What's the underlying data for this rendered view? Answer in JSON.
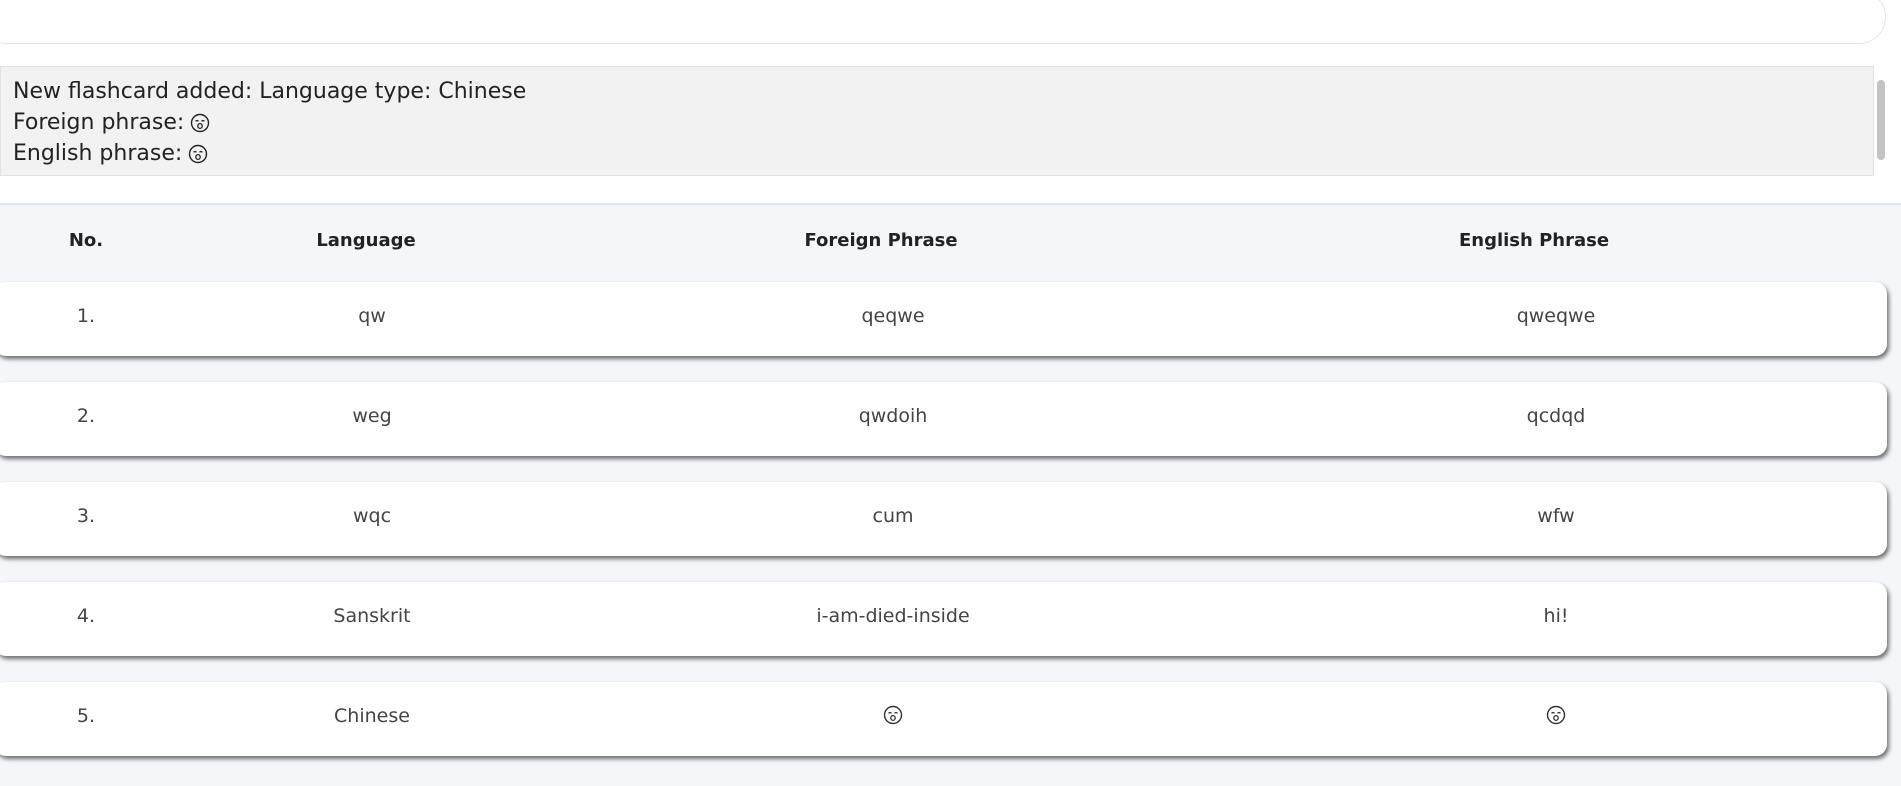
{
  "command": {
    "value": "",
    "placeholder": ""
  },
  "result": {
    "lines": [
      {
        "text": "New flashcard added: Language type: Chinese",
        "emoji": ""
      },
      {
        "text": "Foreign phrase:",
        "emoji": "emoji-icon"
      },
      {
        "text": "English phrase:",
        "emoji": "emoji-icon"
      }
    ]
  },
  "table": {
    "headers": {
      "no": "No.",
      "language": "Language",
      "foreign": "Foreign Phrase",
      "english": "English Phrase"
    },
    "rows": [
      {
        "no": "1.",
        "language": "qw",
        "foreign": "qeqwe",
        "english": "qweqwe"
      },
      {
        "no": "2.",
        "language": "weg",
        "foreign": "qwdoih",
        "english": "qcdqd"
      },
      {
        "no": "3.",
        "language": "wqc",
        "foreign": "cum",
        "english": "wfw"
      },
      {
        "no": "4.",
        "language": "Sanskrit",
        "foreign": "i-am-died-inside",
        "english": "hi!"
      },
      {
        "no": "5.",
        "language": "Chinese",
        "foreign": "emoji",
        "english": "emoji"
      }
    ]
  },
  "colors": {
    "result_bg": "#f2f2f2",
    "table_bg": "#f4f6fa",
    "accent_line": "#dbe7f3"
  }
}
